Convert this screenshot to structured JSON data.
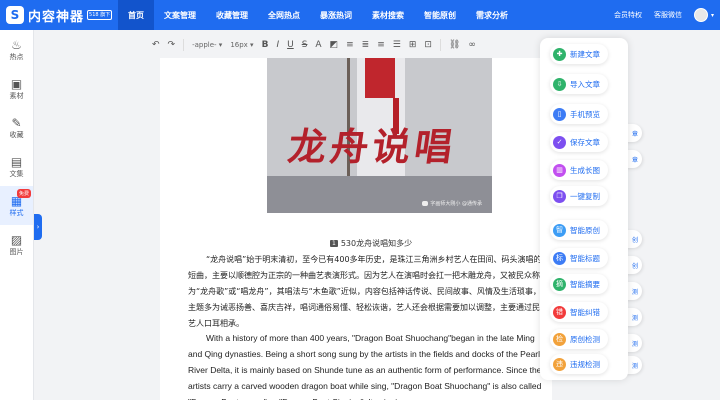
{
  "brand": {
    "name": "内容神器",
    "badge": "518 旗下",
    "mark": "S"
  },
  "nav": [
    {
      "label": "首页",
      "active": true
    },
    {
      "label": "文案管理"
    },
    {
      "label": "收藏管理"
    },
    {
      "label": "全网热点"
    },
    {
      "label": "暴涨热词"
    },
    {
      "label": "素材搜索"
    },
    {
      "label": "智能原创"
    },
    {
      "label": "需求分析"
    }
  ],
  "top_right": {
    "vip": "会员特权",
    "service": "客服微信"
  },
  "sidebar": [
    {
      "label": "热点",
      "icon": "flame-icon",
      "glyph": "♨"
    },
    {
      "label": "素材",
      "icon": "image-library-icon",
      "glyph": "▣"
    },
    {
      "label": "收藏",
      "icon": "bookmark-icon",
      "glyph": "✎"
    },
    {
      "label": "文集",
      "icon": "folder-icon",
      "glyph": "▤"
    },
    {
      "label": "样式",
      "icon": "style-icon",
      "glyph": "▦",
      "active": true,
      "badge": "免费"
    },
    {
      "label": "图片",
      "icon": "picture-icon",
      "glyph": "▨"
    }
  ],
  "toolbar": {
    "font": "-apple-",
    "size": "16px",
    "buttons": [
      "↶",
      "↷",
      "B",
      "I",
      "U",
      "S",
      "A",
      "≡",
      "≡",
      "≡",
      "≡",
      "⊞",
      "⊡",
      "🔗",
      "∞"
    ]
  },
  "figure": {
    "title_art": "龙舟说唱",
    "watermark": "字画师大刚小  @通传承",
    "caption_num": "1",
    "caption": "530龙舟说唱知多少"
  },
  "body": {
    "cn": "“龙舟说唱”始于明末清初，至今已有400多年历史，是珠江三角洲乡村艺人在田间、码头演唱的短曲，主要以顺德腔为正宗的一种曲艺表演形式。因为艺人在演唱时会扛一把木雕龙舟，又被民众称为“龙舟歌”或“唱龙舟”，其唱法与“木鱼歌”近似，内容包括神话传说、民间故事、风情及生活琐事，主题多为诫恶扬善、喜庆吉祥，唱词通俗易懂、轻松诙谐，艺人还会根据需要加以调整，主要通过民间艺人口耳相承。",
    "en": "With a history of more than 400 years, \"Dragon Boat Shuochang\"began in the late Ming and Qing dynasties. Being a short song sung by the artists in the  fields and docks of the Pearl River  Delta, it is  mainly based on Shunde tune  as an authentic form of performance. Since the artists carry a  carved wooden dragon boat while sing, \"Dragon Boat Shuochang\" is also  called \"Dragon Boat songs\" or \"Dragon Boat Singing\". Its singing"
  },
  "float_panel": [
    {
      "label": "新建文章",
      "icon": "new-doc-icon",
      "glyph": "✚",
      "color": "#2fb36b"
    },
    {
      "label": "导入文章",
      "icon": "import-icon",
      "glyph": "⇩",
      "color": "#2fb36b"
    },
    {
      "label": "手机预览",
      "icon": "phone-icon",
      "glyph": "▯",
      "color": "#3d7cf5"
    },
    {
      "label": "保存文章",
      "icon": "save-icon",
      "glyph": "✓",
      "color": "#7d4ff0"
    },
    {
      "label": "生成长图",
      "icon": "long-image-icon",
      "glyph": "▥",
      "color": "#c24ff0"
    },
    {
      "label": "一键复制",
      "icon": "copy-icon",
      "glyph": "❐",
      "color": "#7d4ff0"
    },
    {
      "label": "智能原创",
      "icon": "ai-original-icon",
      "glyph": "智",
      "color": "#3d9df5"
    },
    {
      "label": "智能标题",
      "icon": "ai-title-icon",
      "glyph": "标",
      "color": "#3d7cf5"
    },
    {
      "label": "智能摘要",
      "icon": "ai-summary-icon",
      "glyph": "摘",
      "color": "#2fb36b"
    },
    {
      "label": "智能纠错",
      "icon": "ai-correct-icon",
      "glyph": "错",
      "color": "#f23b3b"
    },
    {
      "label": "原创检测",
      "icon": "originality-check-icon",
      "glyph": "检",
      "color": "#f2a23b"
    },
    {
      "label": "违规检测",
      "icon": "violation-check-icon",
      "glyph": "违",
      "color": "#f2a23b"
    }
  ],
  "edge_chips": [
    "章",
    "章",
    "创",
    "创",
    "测",
    "测",
    "测",
    "测",
    "测"
  ]
}
